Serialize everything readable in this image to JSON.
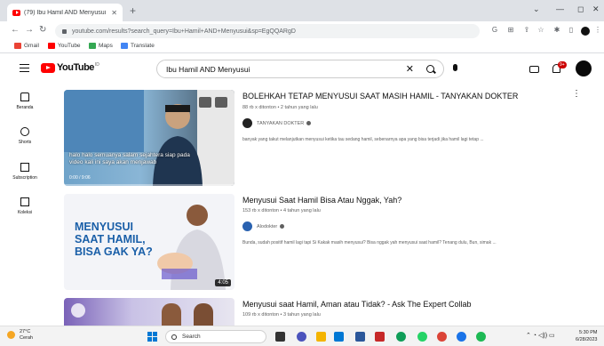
{
  "browser": {
    "tab_title": "(79) Ibu Hamil AND Menyusui",
    "url": "youtube.com/results?search_query=Ibu+Hamil+AND+Menyusui&sp=EgQQARgD",
    "bookmarks": [
      {
        "label": "Gmail",
        "color": "#ea4335"
      },
      {
        "label": "YouTube",
        "color": "#ff0000"
      },
      {
        "label": "Maps",
        "color": "#34a853"
      },
      {
        "label": "Translate",
        "color": "#4285f4"
      }
    ]
  },
  "youtube": {
    "logo_text": "YouTube",
    "logo_country": "ID",
    "search_query": "Ibu Hamil AND Menyusui",
    "notification_count": "9+",
    "guide": [
      {
        "label": "Beranda",
        "icon": "home-icon"
      },
      {
        "label": "Shorts",
        "icon": "shorts-icon"
      },
      {
        "label": "Subscription",
        "icon": "subscriptions-icon"
      },
      {
        "label": "Koleksi",
        "icon": "library-icon"
      }
    ]
  },
  "results": [
    {
      "title": "BOLEHKAH TETAP MENYUSUI SAAT MASIH HAMIL - TANYAKAN DOKTER",
      "meta": "88 rb x ditonton • 2 tahun yang lalu",
      "channel": "TANYAKAN DOKTER",
      "description": "banyak yang takut melanjutkan menyusui ketika tau sedang hamil, sebenarnya apa yang bisa terjadi jika hamil lagi tetap ...",
      "caption": "halo halo semuanya salam sejahtera siap pada video kali ini saya akan menjawab",
      "duration": "0:00 / 9:06"
    },
    {
      "title": "Menyusui Saat Hamil Bisa Atau Nggak, Yah?",
      "meta": "153 rb x ditonton • 4 tahun yang lalu",
      "channel": "Alodokter",
      "description": "Bunda, sudah positif hamil lagi tapi Si Kakak masih menyusui? Bisa nggak yah menyusui saat hamil? Tenang dulu, Bun, simak ...",
      "thumb_text": "MENYUSUI SAAT HAMIL, BISA GAK YA?",
      "duration": "4:05"
    },
    {
      "title": "Menyusui saat Hamil, Aman atau Tidak? - Ask The Expert Collab",
      "meta": "109 rb x ditonton • 3 tahun yang lalu"
    }
  ],
  "taskbar": {
    "temperature": "27°C",
    "weather": "Cerah",
    "search_label": "Search",
    "time": "5:30 PM",
    "date": "6/28/2023"
  },
  "colors": {
    "youtube_red": "#ff0000",
    "tab_strip": "#dee1e6",
    "thumb2_text": "#1a5fa8"
  }
}
